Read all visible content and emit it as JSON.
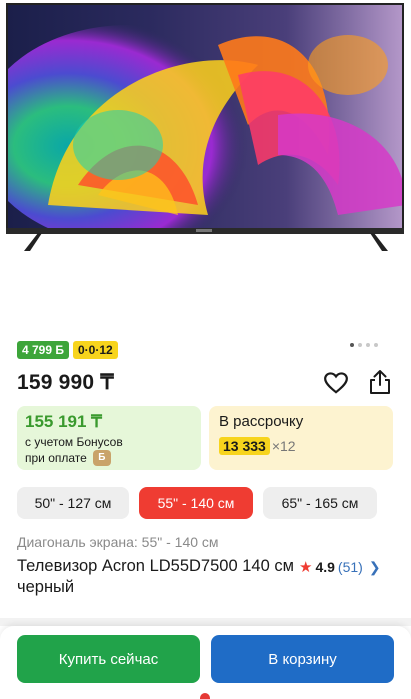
{
  "product": {
    "price": "159 990 ₸",
    "title": "Телевизор Acron LD55D7500 140 см черный",
    "diagonal_text": "Диагональ экрана: 55\" - 140 см",
    "image": {
      "carousel_dots": 4,
      "active_dot": 0
    }
  },
  "badges": {
    "bonus": "4 799 Б",
    "installment": "0·0·12"
  },
  "bonus_card": {
    "price": "155 191 ₸",
    "note_line1": "с учетом Бонусов",
    "note_line2": "при оплате",
    "coin_icon": "bonus-coin-icon"
  },
  "installment_card": {
    "title": "В рассрочку",
    "amount": "13 333",
    "multiplier": "×12"
  },
  "sizes": [
    {
      "label": "50\" - 127 см",
      "selected": false
    },
    {
      "label": "55\" - 140 см",
      "selected": true
    },
    {
      "label": "65\" - 165 см",
      "selected": false
    }
  ],
  "rating": {
    "value": "4.9",
    "count": "(51)"
  },
  "actions": {
    "buy_now": "Купить сейчас",
    "add_to_cart": "В корзину"
  },
  "icons": {
    "favorite": "heart-icon",
    "share": "share-icon",
    "star": "star-icon",
    "chevron": "chevron-right-icon"
  },
  "colors": {
    "accent_red": "#ef3c32",
    "buy_green": "#21a34a",
    "cart_blue": "#1f6cc6",
    "bonus_green": "#3da53a",
    "installment_yellow": "#f7d41d"
  }
}
